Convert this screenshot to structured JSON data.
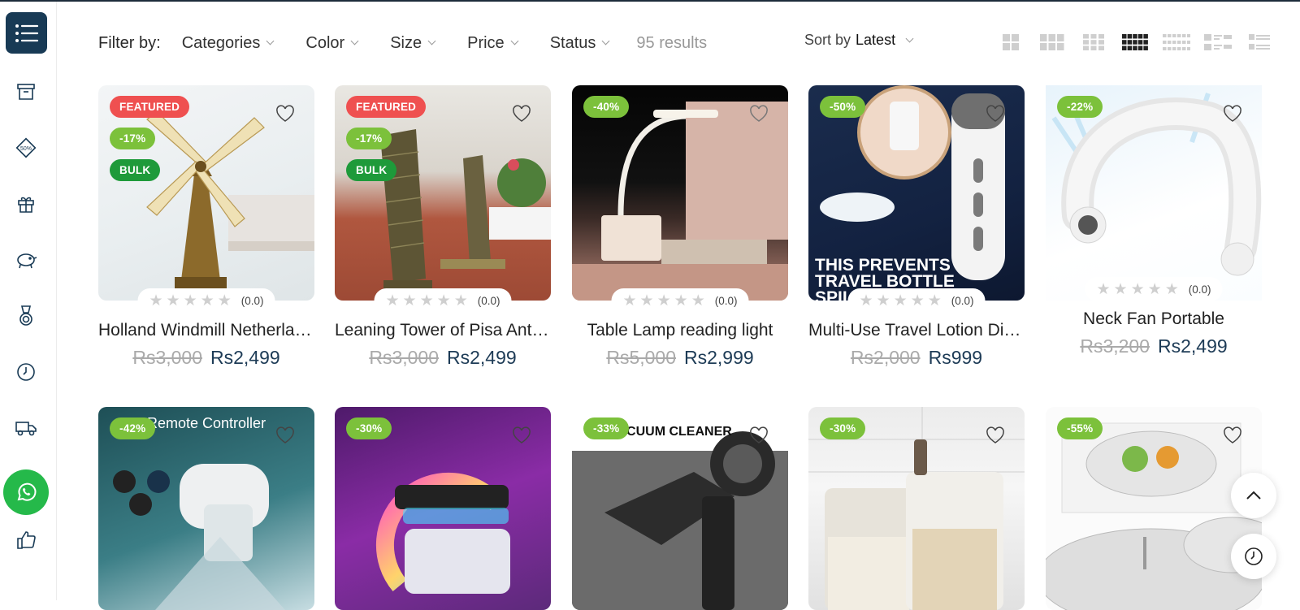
{
  "filter": {
    "label": "Filter by:",
    "items": [
      "Categories",
      "Color",
      "Size",
      "Price",
      "Status"
    ],
    "results": "95 results"
  },
  "sort": {
    "prefix": "Sort by",
    "value": "Latest"
  },
  "colors": {
    "navy": "#183a55",
    "featured": "#ef5050",
    "sale": "#7cc13b",
    "bulk": "#1e9a3a",
    "whatsapp": "#25b94a"
  },
  "sidebar": {
    "icons": [
      "archive-icon",
      "discount-tag-icon",
      "gift-icon",
      "piggy-bank-icon",
      "medal-icon",
      "clock-icon",
      "truck-icon",
      "whatsapp-icon",
      "thumbs-up-icon"
    ],
    "discount_tag_text": "50%"
  },
  "products": [
    {
      "name": "Holland Windmill Netherlands",
      "old_price": "Rs3,000",
      "price": "Rs2,499",
      "rating": "(0.0)",
      "badges": [
        "FEATURED",
        "-17%",
        "BULK"
      ]
    },
    {
      "name": "Leaning Tower of Pisa Antique",
      "old_price": "Rs3,000",
      "price": "Rs2,499",
      "rating": "(0.0)",
      "badges": [
        "FEATURED",
        "-17%",
        "BULK"
      ]
    },
    {
      "name": "Table Lamp reading light",
      "old_price": "Rs5,000",
      "price": "Rs2,999",
      "rating": "(0.0)",
      "badges": [
        "-40%"
      ]
    },
    {
      "name": "Multi-Use Travel Lotion Dispenser",
      "old_price": "Rs2,000",
      "price": "Rs999",
      "rating": "(0.0)",
      "badges": [
        "-50%"
      ],
      "image_text": "THIS PREVENTS TRAVEL BOTTLE SPILLS"
    },
    {
      "name": "Neck Fan Portable",
      "old_price": "Rs3,200",
      "price": "Rs2,499",
      "rating": "(0.0)",
      "badges": [
        "-22%"
      ]
    },
    {
      "badges": [
        "-42%"
      ],
      "image_text": "Remote Controller"
    },
    {
      "badges": [
        "-30%"
      ]
    },
    {
      "badges": [
        "-33%"
      ],
      "image_text": "VACUUM CLEANER"
    },
    {
      "badges": [
        "-30%"
      ]
    },
    {
      "badges": [
        "-55%"
      ]
    }
  ]
}
